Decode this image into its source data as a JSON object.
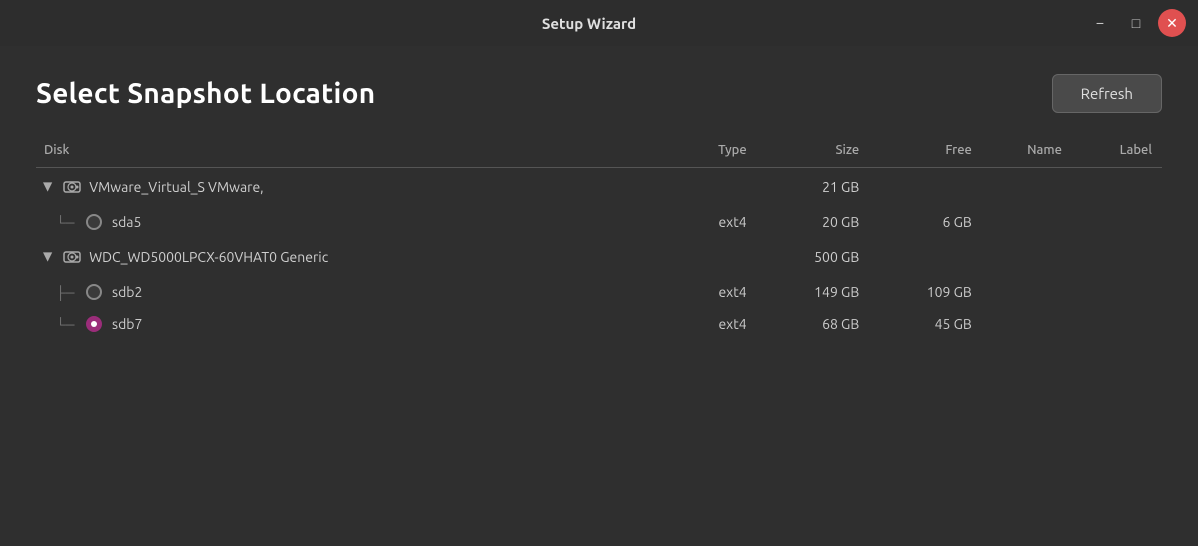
{
  "titlebar": {
    "title": "Setup Wizard",
    "minimize_label": "−",
    "maximize_label": "□",
    "close_label": "✕"
  },
  "header": {
    "title": "Select Snapshot Location",
    "refresh_label": "Refresh"
  },
  "table": {
    "columns": [
      {
        "key": "disk",
        "label": "Disk"
      },
      {
        "key": "type",
        "label": "Type"
      },
      {
        "key": "size",
        "label": "Size"
      },
      {
        "key": "free",
        "label": "Free"
      },
      {
        "key": "name",
        "label": "Name"
      },
      {
        "key": "label",
        "label": "Label"
      }
    ],
    "disks": [
      {
        "id": "vmware",
        "name": "VMware_Virtual_S",
        "vendor": "VMware,",
        "size": "21 GB",
        "partitions": [
          {
            "id": "sda5",
            "name": "sda5",
            "type": "ext4",
            "size": "20 GB",
            "free": "6 GB",
            "selected": false,
            "last": true
          }
        ]
      },
      {
        "id": "wdc",
        "name": "WDC_WD5000LPCX-60VHAT0",
        "vendor": "Generic",
        "size": "500 GB",
        "partitions": [
          {
            "id": "sdb2",
            "name": "sdb2",
            "type": "ext4",
            "size": "149 GB",
            "free": "109 GB",
            "selected": false,
            "last": false
          },
          {
            "id": "sdb7",
            "name": "sdb7",
            "type": "ext4",
            "size": "68 GB",
            "free": "45 GB",
            "selected": true,
            "last": true
          }
        ]
      }
    ]
  }
}
